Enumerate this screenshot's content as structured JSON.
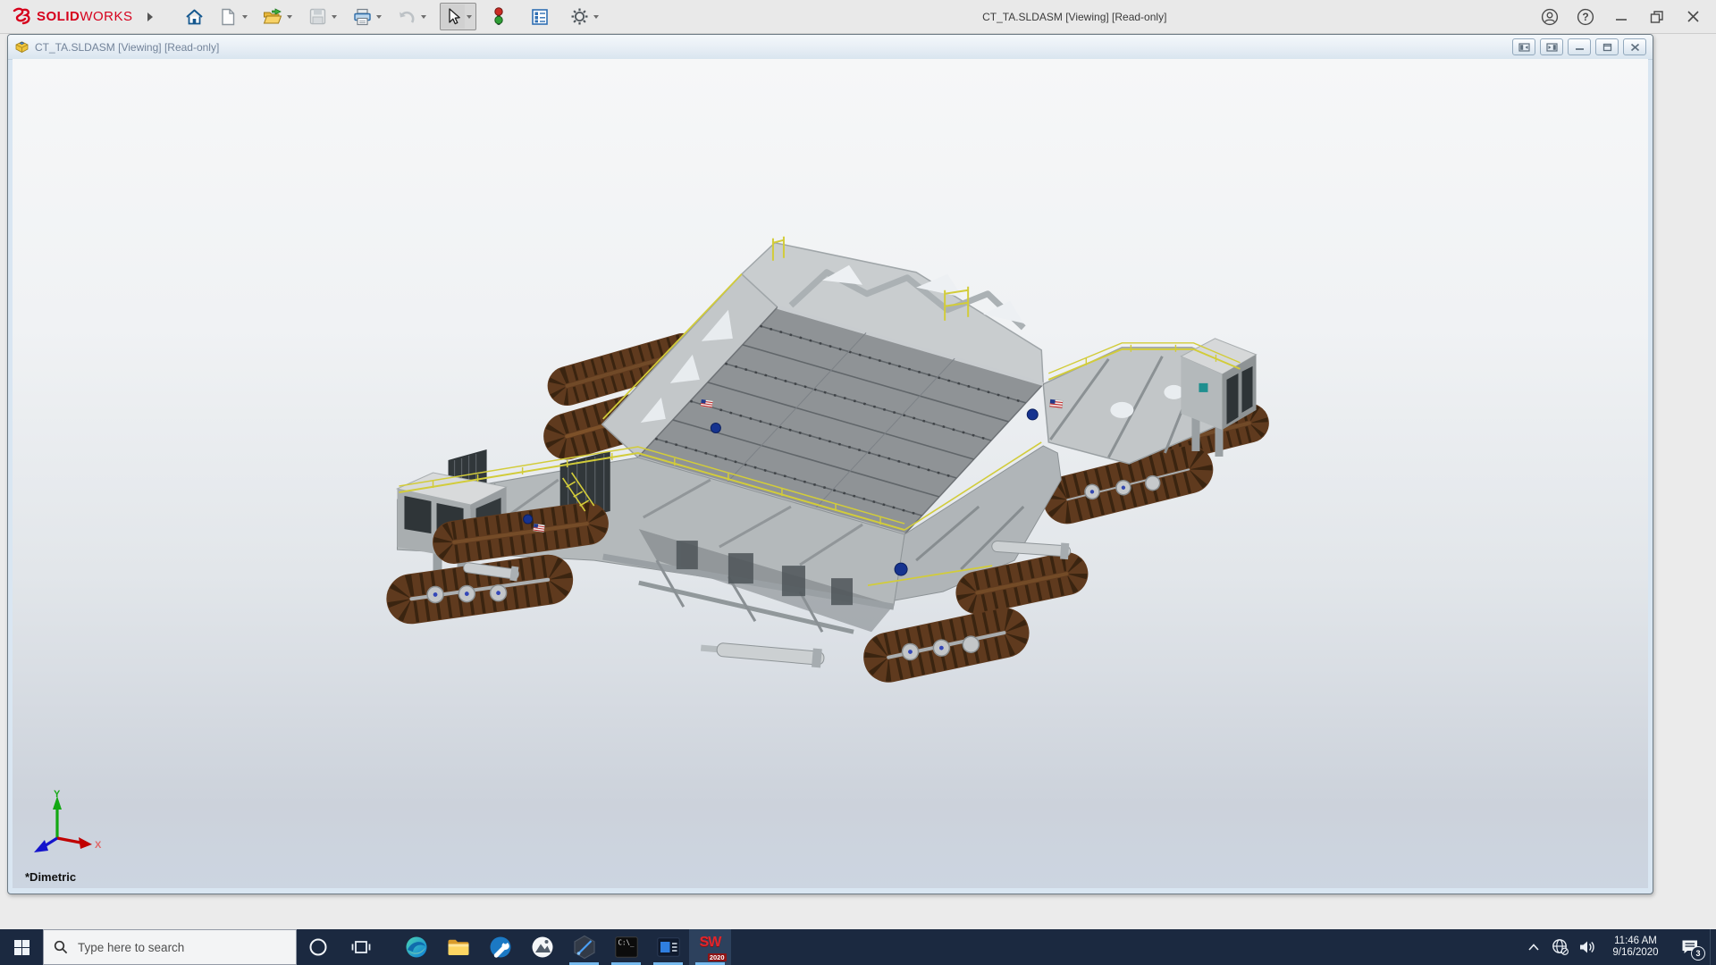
{
  "app": {
    "brand_bold": "SOLID",
    "brand_light": "WORKS",
    "title": "CT_TA.SLDASM [Viewing] [Read-only]",
    "help_glyph": "?",
    "window_control_icons": [
      "account-icon",
      "help-icon",
      "minimize-icon",
      "restore-icon",
      "close-icon"
    ]
  },
  "toolbar": {
    "icons": [
      "home-icon",
      "new-document-icon",
      "open-folder-icon",
      "save-icon",
      "print-icon",
      "undo-icon",
      "select-cursor-icon",
      "performance-stoplight-icon",
      "task-pane-icon",
      "settings-gear-icon"
    ],
    "selected_tool": "select-cursor"
  },
  "document_window": {
    "title": "CT_TA.SLDASM [Viewing] [Read-only]",
    "icon": "assembly-cube-icon",
    "window_control_icons": [
      "collapse-left-pane-icon",
      "collapse-right-pane-icon",
      "minimize-icon",
      "restore-icon",
      "close-icon"
    ],
    "viewport": {
      "view_orientation_label": "*Dimetric",
      "triad": {
        "x_label": "X",
        "y_label": "Y"
      },
      "model_description": "NASA crawler-transporter assembly with four tracked trucks, gray deck and yellow railings"
    }
  },
  "taskbar": {
    "search": {
      "placeholder": "Type here to search",
      "icon": "search-icon"
    },
    "button_icons": [
      "windows-start-icon",
      "cortana-icon",
      "task-view-icon",
      "edge-browser-icon",
      "file-explorer-icon",
      "support-wrench-icon",
      "photos-icon",
      "paint3d-hexagon-icon",
      "command-prompt-icon",
      "media-window-icon",
      "solidworks-2020-icon"
    ],
    "running_buttons": [
      "paint-3d",
      "command-prompt",
      "media-window",
      "solidworks-2020"
    ],
    "command_prompt_label": "C:\\_",
    "solidworks_badge": {
      "letters": "SW",
      "year": "2020"
    },
    "tray": {
      "icons": [
        "chevron-up-icon",
        "globe-no-internet-icon",
        "speaker-icon",
        "notification-icon"
      ],
      "time": "11:46 AM",
      "date": "9/16/2020",
      "notification_count": "3"
    }
  },
  "colors": {
    "taskbar_bg": "#1b2940",
    "running_indicator": "#76b9ed",
    "brand_red": "#d6001c",
    "tread_brown": "#5f3a1e",
    "railing_yellow": "#d2cc3a",
    "viewport_top": "#f6f7f8",
    "viewport_bottom": "#ccd5e1"
  }
}
